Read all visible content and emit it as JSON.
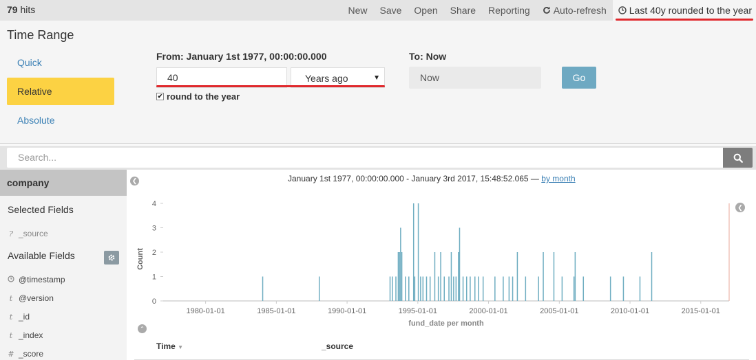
{
  "hits": {
    "count": "79",
    "label": "hits"
  },
  "top_menu": {
    "new": "New",
    "save": "Save",
    "open": "Open",
    "share": "Share",
    "reporting": "Reporting",
    "auto_refresh": "Auto-refresh",
    "time_picker": "Last 40y rounded to the year"
  },
  "time_range": {
    "title": "Time Range",
    "tabs": [
      "Quick",
      "Relative",
      "Absolute"
    ],
    "active_tab": "Relative",
    "from_label": "From: January 1st 1977, 00:00:00.000",
    "from_value": "40",
    "from_unit": "Years ago",
    "round_label": "round to the year",
    "round_checked": true,
    "to_label": "To: Now",
    "to_value": "Now",
    "go": "Go"
  },
  "search": {
    "placeholder": "Search..."
  },
  "sidebar": {
    "index": "company",
    "selected_title": "Selected Fields",
    "selected_fields": [
      {
        "type": "?",
        "name": "_source"
      }
    ],
    "available_title": "Available Fields",
    "available_fields": [
      {
        "type": "clock",
        "name": "@timestamp"
      },
      {
        "type": "t",
        "name": "@version"
      },
      {
        "type": "t",
        "name": "_id"
      },
      {
        "type": "t",
        "name": "_index"
      },
      {
        "type": "#",
        "name": "_score"
      }
    ]
  },
  "chart_header": {
    "range": "January 1st 1977, 00:00:00.000 - January 3rd 2017, 15:48:52.065 —",
    "interval": "by month"
  },
  "chart_data": {
    "type": "bar",
    "xlabel": "fund_date per month",
    "ylabel": "Count",
    "ylim": [
      0,
      4
    ],
    "y_ticks": [
      0,
      1,
      2,
      3,
      4
    ],
    "x_ticks": [
      "1980-01-01",
      "1985-01-01",
      "1990-01-01",
      "1995-01-01",
      "2000-01-01",
      "2005-01-01",
      "2010-01-01",
      "2015-01-01"
    ],
    "x_range": [
      "1977-01-01",
      "2017-01-03"
    ],
    "color": "#6eadc1",
    "points": [
      {
        "x": "1984-01",
        "y": 1
      },
      {
        "x": "1988-01",
        "y": 1
      },
      {
        "x": "1993-01",
        "y": 1
      },
      {
        "x": "1993-03",
        "y": 1
      },
      {
        "x": "1993-06",
        "y": 1
      },
      {
        "x": "1993-08",
        "y": 2
      },
      {
        "x": "1993-09",
        "y": 2
      },
      {
        "x": "1993-10",
        "y": 3
      },
      {
        "x": "1993-11",
        "y": 2
      },
      {
        "x": "1994-02",
        "y": 1
      },
      {
        "x": "1994-05",
        "y": 1
      },
      {
        "x": "1994-09",
        "y": 4
      },
      {
        "x": "1994-10",
        "y": 1
      },
      {
        "x": "1995-01",
        "y": 4
      },
      {
        "x": "1995-03",
        "y": 1
      },
      {
        "x": "1995-05",
        "y": 1
      },
      {
        "x": "1995-08",
        "y": 1
      },
      {
        "x": "1995-11",
        "y": 1
      },
      {
        "x": "1996-03",
        "y": 2
      },
      {
        "x": "1996-06",
        "y": 1
      },
      {
        "x": "1996-08",
        "y": 2
      },
      {
        "x": "1996-11",
        "y": 1
      },
      {
        "x": "1997-03",
        "y": 1
      },
      {
        "x": "1997-05",
        "y": 2
      },
      {
        "x": "1997-07",
        "y": 1
      },
      {
        "x": "1997-09",
        "y": 1
      },
      {
        "x": "1997-11",
        "y": 2
      },
      {
        "x": "1997-12",
        "y": 3
      },
      {
        "x": "1998-03",
        "y": 1
      },
      {
        "x": "1998-06",
        "y": 1
      },
      {
        "x": "1998-09",
        "y": 1
      },
      {
        "x": "1999-01",
        "y": 1
      },
      {
        "x": "1999-04",
        "y": 1
      },
      {
        "x": "1999-08",
        "y": 1
      },
      {
        "x": "2000-06",
        "y": 1
      },
      {
        "x": "2001-01",
        "y": 1
      },
      {
        "x": "2001-06",
        "y": 1
      },
      {
        "x": "2001-09",
        "y": 1
      },
      {
        "x": "2002-01",
        "y": 2
      },
      {
        "x": "2002-08",
        "y": 1
      },
      {
        "x": "2003-07",
        "y": 1
      },
      {
        "x": "2003-11",
        "y": 2
      },
      {
        "x": "2004-08",
        "y": 2
      },
      {
        "x": "2005-03",
        "y": 1
      },
      {
        "x": "2006-01",
        "y": 1
      },
      {
        "x": "2006-02",
        "y": 2
      },
      {
        "x": "2006-09",
        "y": 1
      },
      {
        "x": "2008-08",
        "y": 1
      },
      {
        "x": "2009-07",
        "y": 1
      },
      {
        "x": "2010-09",
        "y": 1
      },
      {
        "x": "2011-07",
        "y": 2
      }
    ]
  },
  "docs_table": {
    "columns": [
      "Time",
      "_source"
    ]
  },
  "colors": {
    "accent": "#fcd243",
    "link": "#3c81b5",
    "underline": "#e0282c",
    "bars": "#6eadc1"
  }
}
